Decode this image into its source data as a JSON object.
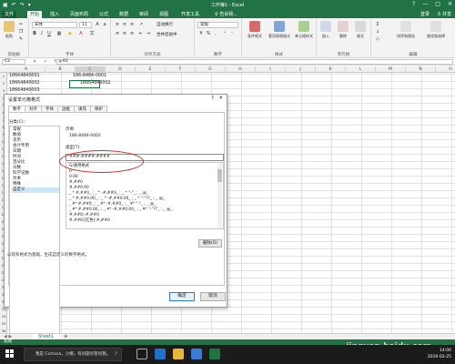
{
  "app": {
    "title": "工作簿1 - Excel",
    "qat_icons": [
      "save-icon",
      "undo-icon",
      "redo-icon",
      "customize-icon"
    ],
    "window_buttons": [
      "?",
      "—",
      "□",
      "✕"
    ]
  },
  "ribbon_tabs": {
    "file": "文件",
    "items": [
      "开始",
      "插入",
      "页面布局",
      "公式",
      "数据",
      "审阅",
      "视图",
      "开发工具"
    ],
    "tell_me": "♀ 告诉我…",
    "sign_in": "登录",
    "share": "♁ 共享"
  },
  "ribbon": {
    "font_name": "宋体",
    "font_size": "11",
    "groups": [
      "剪贴板",
      "字体",
      "对齐方式",
      "数字",
      "样式",
      "单元格",
      "编辑"
    ],
    "paste": "粘贴",
    "number_format": "常规",
    "wrap": "自动换行",
    "merge": "合并后居中",
    "conditional": "条件格式",
    "table_format": "套用表格格式",
    "cell_styles": "单元格样式",
    "insert": "插入",
    "delete": "删除",
    "format": "格式",
    "sort": "排序和筛选",
    "find": "查找和选择"
  },
  "formula_bar": {
    "name_box": "C2",
    "icons": "✕ ✓ fx",
    "formula": "=A2"
  },
  "grid": {
    "columns": [
      "A",
      "B",
      "C",
      "D",
      "E",
      "F",
      "G",
      "H",
      "I",
      "J",
      "K",
      "L",
      "M",
      "N",
      "O"
    ],
    "row_numbers": [
      "1",
      "2",
      "3",
      "4",
      "5",
      "6",
      "7",
      "8",
      "9",
      "10",
      "11",
      "12",
      "13",
      "14",
      "15",
      "16",
      "17",
      "18",
      "19",
      "20",
      "21",
      "22",
      "23",
      "24",
      "25",
      "26",
      "27",
      "28",
      "29",
      "30",
      "31",
      "32",
      "33",
      "34",
      "35",
      "36"
    ],
    "cells": {
      "a1": "18664840001",
      "a2": "18664840002",
      "a3": "18664840003",
      "c1": "186-8484-0001",
      "c2": "18664840002",
      "a35": "18664840035",
      "a36": "18664840036",
      "a37": "18664840037",
      "a38": "18664840038"
    },
    "extra_row_numbers": [
      "35",
      "36",
      "37",
      "38"
    ]
  },
  "dialog": {
    "title": "设置单元格格式",
    "help": "?",
    "close": "✕",
    "tabs": [
      "数字",
      "对齐",
      "字体",
      "边框",
      "填充",
      "保护"
    ],
    "category_label": "分类(C):",
    "categories": [
      "常规",
      "数值",
      "货币",
      "会计专用",
      "日期",
      "时间",
      "百分比",
      "分数",
      "科学记数",
      "文本",
      "特殊",
      "自定义"
    ],
    "selected_category": "自定义",
    "sample_label": "示例",
    "sample_value": "186-8484-0002",
    "type_label": "类型(T):",
    "type_value": "###-####-####",
    "type_options": [
      "G/通用格式",
      "0",
      "0.00",
      "#,##0",
      "#,##0.00",
      "_ * #,##0_ ; _ * -#,##0_ ; _ * \"-\"_ ; _ @_",
      "_ * #,##0.00_ ; _ * -#,##0.00_ ; _ * \"-\"??_ ; _ @_",
      "_ ¥* #,##0_ ; _ ¥* -#,##0_ ; _ ¥* \"-\"_ ; _ @_",
      "_ ¥* #,##0.00_ ; _ ¥* -#,##0.00_ ; _ ¥* \"-\"??_ ; _ @_",
      "#,##0;-#,##0",
      "#,##0;[红色]-#,##0"
    ],
    "delete_button": "删除(D)",
    "description": "以现有格式为基础，生成自定义的数字格式。",
    "ok": "确定",
    "cancel": "取消"
  },
  "sheetbar": {
    "nav": "◀ ▶",
    "sheet": "Sheet1",
    "add": "⊕"
  },
  "status": {
    "ready": "就绪"
  },
  "taskbar": {
    "search_placeholder": "我是 Cortana，小娜。有问题尽管问我。",
    "time": "14:00",
    "date": "2016-02-25"
  },
  "watermark": "jingyan.baidu.com",
  "colors": {
    "excel_green": "#217346",
    "highlight_ellipse": "#d12b2b",
    "selected_item": "#cde6f7"
  }
}
